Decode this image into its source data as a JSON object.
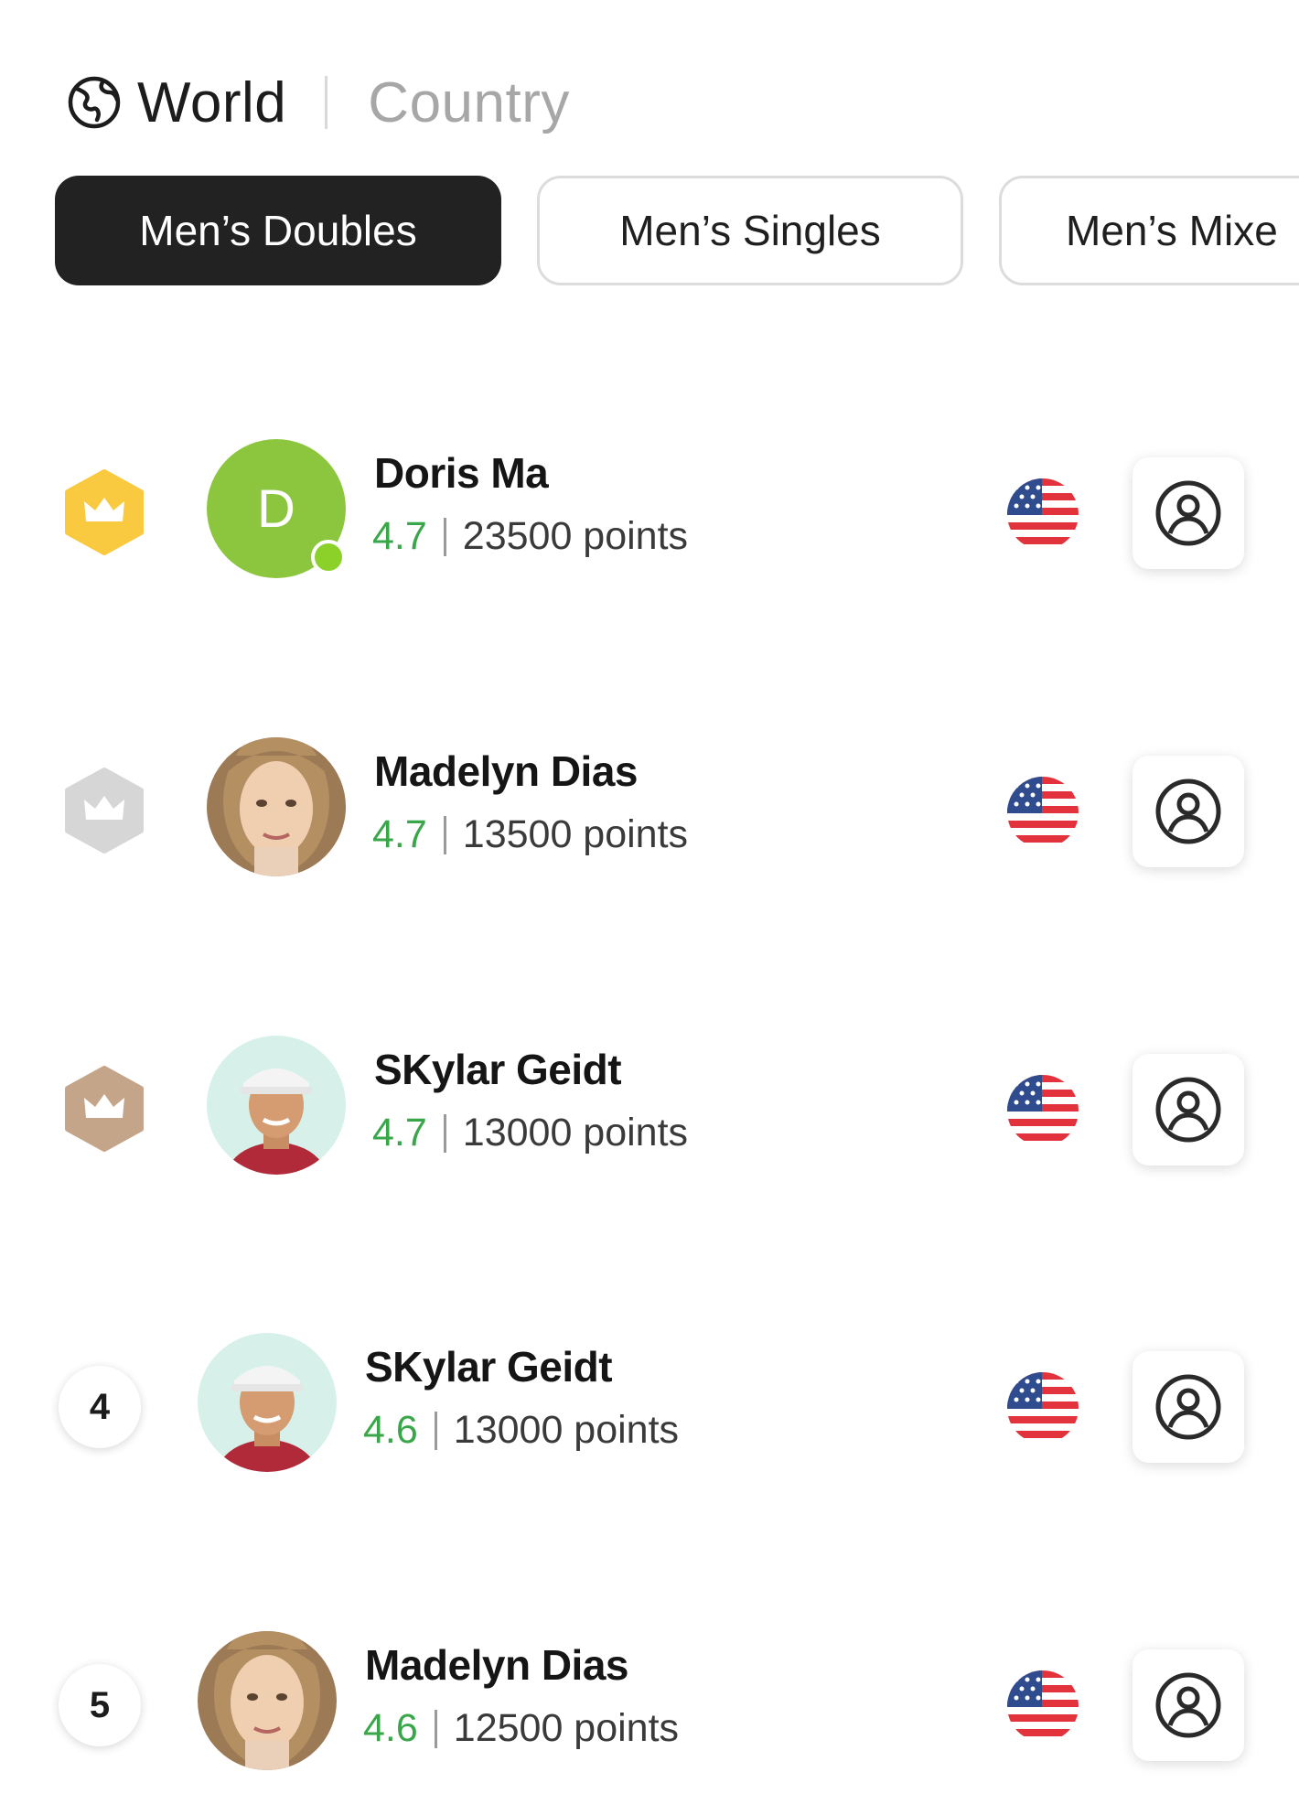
{
  "scope": {
    "world_label": "World",
    "country_label": "Country",
    "world_icon": "globe-icon"
  },
  "tabs": [
    {
      "label": "Men’s Doubles",
      "active": true
    },
    {
      "label": "Men’s Singles",
      "active": false
    },
    {
      "label": "Men’s Mixe",
      "active": false
    }
  ],
  "players": [
    {
      "rank_badge": "gold-crown-icon",
      "name": "Doris Ma",
      "rating": "4.7",
      "points": "23500 points",
      "avatar_letter": "D",
      "avatar_color": "#8cc63f",
      "online": true,
      "country_flag": "us-flag-icon"
    },
    {
      "rank_badge": "silver-crown-icon",
      "name": "Madelyn Dias",
      "rating": "4.7",
      "points": "13500 points",
      "country_flag": "us-flag-icon"
    },
    {
      "rank_badge": "bronze-crown-icon",
      "name": "SKylar Geidt",
      "rating": "4.7",
      "points": "13000 points",
      "country_flag": "us-flag-icon"
    },
    {
      "rank_number": "4",
      "name": "SKylar Geidt",
      "rating": "4.6",
      "points": "13000 points",
      "country_flag": "us-flag-icon"
    },
    {
      "rank_number": "5",
      "name": "Madelyn Dias",
      "rating": "4.6",
      "points": "12500 points",
      "country_flag": "us-flag-icon"
    }
  ],
  "colors": {
    "gold": "#f9c93f",
    "silver": "#d6d6d6",
    "bronze": "#c5a58a",
    "rating_green": "#3aa64a",
    "active_tab": "#222222"
  }
}
